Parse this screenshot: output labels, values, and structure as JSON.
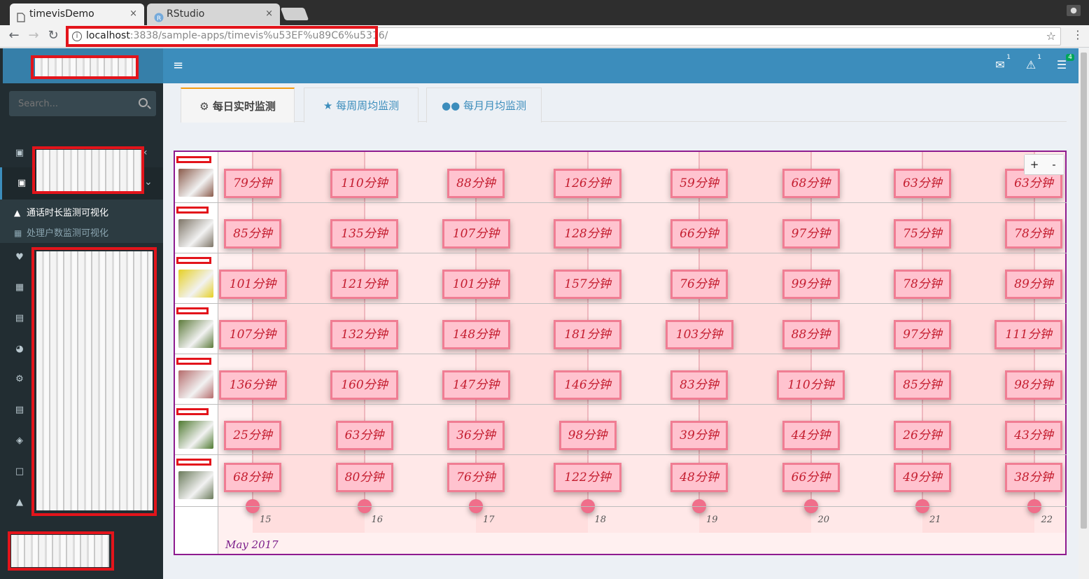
{
  "browser": {
    "tabs": [
      {
        "title": "timevisDemo",
        "close": "×"
      },
      {
        "title": "RStudio",
        "close": "×"
      }
    ],
    "url_host": "localhost",
    "url_path": ":3838/sample-apps/timevis%u53EF%u89C6%u5316/",
    "icons": [
      "back-arrow-icon",
      "forward-arrow-icon",
      "reload-icon",
      "info-icon",
      "star-icon",
      "menu-dots-icon"
    ]
  },
  "sidebar": {
    "search_placeholder": "Search...",
    "submenu": [
      {
        "label": "通话时长监测可视化",
        "icon": "area-chart-icon",
        "active": true
      },
      {
        "label": "处理户数监测可视化",
        "icon": "windows-icon",
        "active": false
      }
    ],
    "icons": [
      "image-icon",
      "image-icon",
      "heart-icon",
      "table-icon",
      "file-text-icon",
      "dashboard-icon",
      "gear-icon",
      "list-icon",
      "puzzle-icon",
      "file-icon",
      "bell-icon"
    ]
  },
  "header": {
    "menu_icon": "≡",
    "badges": [
      {
        "icon": "envelope-icon",
        "count": "1",
        "color": "#3c8dbc"
      },
      {
        "icon": "warning-icon",
        "count": "1",
        "color": "#3c8dbc"
      },
      {
        "icon": "tasks-icon",
        "count": "4",
        "color": "#00a65a"
      }
    ]
  },
  "tabs": [
    {
      "label": "每日实时监测",
      "icon": "gear-icon",
      "active": true
    },
    {
      "label": "每周周均监测",
      "icon": "trophy-icon",
      "active": false
    },
    {
      "label": "每月月均监测",
      "icon": "users-icon",
      "active": false
    }
  ],
  "timeline": {
    "zoom_in": "+",
    "zoom_out": "-",
    "month_label": "May 2017",
    "day_labels": [
      "15",
      "16",
      "17",
      "18",
      "19",
      "20",
      "21",
      "22"
    ],
    "unit": "分钟",
    "groups": [
      {
        "avatar_color": "#8a5a4a",
        "values": [
          "79",
          "110",
          "88",
          "126",
          "59",
          "68",
          "63",
          "63"
        ]
      },
      {
        "avatar_color": "#7d7466",
        "values": [
          "85",
          "135",
          "107",
          "128",
          "66",
          "97",
          "75",
          "78"
        ]
      },
      {
        "avatar_color": "#e6d024",
        "values": [
          "101",
          "121",
          "101",
          "157",
          "76",
          "99",
          "78",
          "89"
        ]
      },
      {
        "avatar_color": "#5c7a3a",
        "values": [
          "107",
          "132",
          "148",
          "181",
          "103",
          "88",
          "97",
          "111"
        ]
      },
      {
        "avatar_color": "#b56b6b",
        "values": [
          "136",
          "160",
          "147",
          "146",
          "83",
          "110",
          "85",
          "98"
        ]
      },
      {
        "avatar_color": "#4f7a30",
        "values": [
          "25",
          "63",
          "36",
          "98",
          "39",
          "44",
          "26",
          "43"
        ]
      },
      {
        "avatar_color": "#6a7a5a",
        "values": [
          "68",
          "80",
          "76",
          "122",
          "48",
          "66",
          "49",
          "38"
        ]
      }
    ],
    "colors": {
      "item_bg": "#ffc3cf",
      "item_border": "#f07d93",
      "item_text": "#c41d2f",
      "frame": "#8e1b8f"
    }
  }
}
